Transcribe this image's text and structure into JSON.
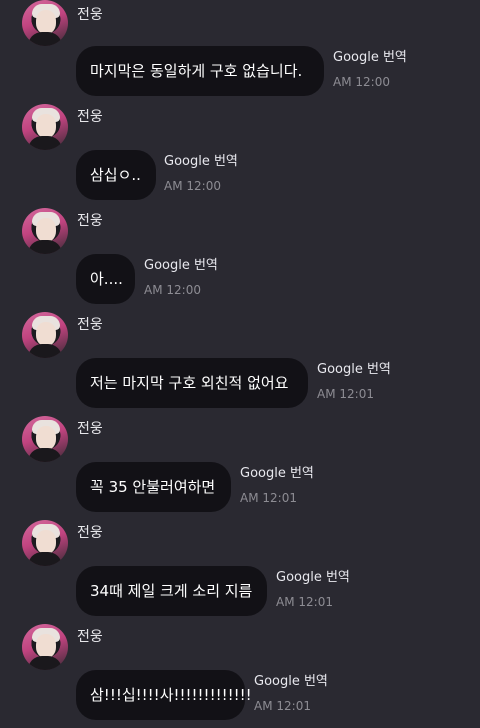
{
  "sender_name": "전웅",
  "translate_label": "Google 번역",
  "messages": [
    {
      "text": "마지막은 동일하게 구호 없습니다.",
      "time": "AM 12:00"
    },
    {
      "text": "삼십ㅇ..",
      "time": "AM 12:00"
    },
    {
      "text": "아....",
      "time": "AM 12:00"
    },
    {
      "text": "저는 마지막 구호 외친적 없어요",
      "time": "AM 12:01"
    },
    {
      "text": "꼭 35 안불러여하면",
      "time": "AM 12:01"
    },
    {
      "text": "34때 제일 크게 소리 지름",
      "time": "AM 12:01"
    },
    {
      "text": "삼!!!십!!!!사!!!!!!!!!!!!!",
      "time": "AM 12:01"
    }
  ],
  "colors": {
    "background": "#2a2931",
    "bubble": "#121116",
    "time": "#8d8c93"
  }
}
